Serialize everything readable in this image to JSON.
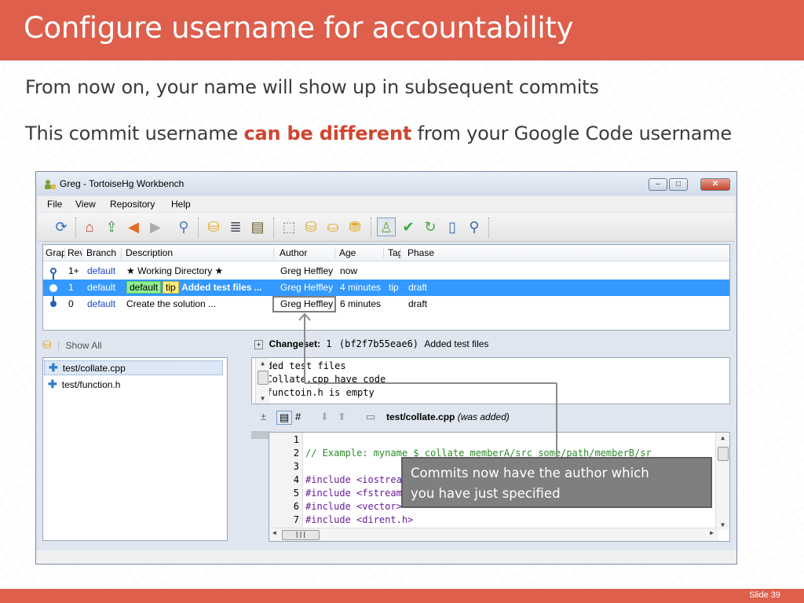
{
  "slide": {
    "title": "Configure username for accountability",
    "line1": "From now on, your name will show up in subsequent commits",
    "line2_pre": "This commit username ",
    "line2_highlight": "can be different",
    "line2_post": " from your Google Code username",
    "slide_number": "Slide 39",
    "accent_color": "#dd5f4c",
    "highlight_color": "#d0452f"
  },
  "window": {
    "title": "Greg - TortoiseHg Workbench",
    "minimize": "–",
    "maximize": "□",
    "close": "✕"
  },
  "menu": [
    "File",
    "View",
    "Repository",
    "Help"
  ],
  "grid": {
    "headers": [
      "Grap",
      "Rev",
      "Branch",
      "Description",
      "Author",
      "Age",
      "Tag",
      "Phase"
    ],
    "rows": [
      {
        "rev": "1+",
        "branch": "default",
        "description": "★ Working Directory ★",
        "author": "Greg Heffley",
        "age": "now",
        "tags": "",
        "phase": ""
      },
      {
        "rev": "1",
        "branch": "default",
        "tag_branch": "default",
        "tag_tip": "tip",
        "description": "Added test files ...",
        "author": "Greg Heffley",
        "age": "4 minutes",
        "tags": "tip",
        "phase": "draft"
      },
      {
        "rev": "0",
        "branch": "default",
        "description": "Create the solution ...",
        "author": "Greg Heffley",
        "age": "6 minutes",
        "tags": "",
        "phase": "draft"
      }
    ],
    "selected_color": "#3399ff"
  },
  "files": {
    "show_all": "Show All",
    "items": [
      "test/collate.cpp",
      "test/function.h"
    ]
  },
  "changeset": {
    "label": "Changeset:",
    "rev": "1",
    "hash": "(bf2f7b55eae6)",
    "summary": "Added test files",
    "message": [
      "Added test files",
      "- Collate.cpp have code",
      "- functoin.h is empty"
    ]
  },
  "diff": {
    "filename": "test/collate.cpp",
    "status": "(was added)",
    "lines": [
      {
        "n": "1",
        "text": ""
      },
      {
        "n": "2",
        "text": "// Example: myname $ collate memberA/src some/path/memberB/sr"
      },
      {
        "n": "3",
        "text": ""
      },
      {
        "n": "4",
        "text": "#include <iostream>"
      },
      {
        "n": "5",
        "text": "#include <fstream>"
      },
      {
        "n": "6",
        "text": "#include <vector>"
      },
      {
        "n": "7",
        "text": "#include <dirent.h>"
      }
    ]
  },
  "callout": {
    "line1": "Commits now have the author which",
    "line2": "you have just specified"
  }
}
